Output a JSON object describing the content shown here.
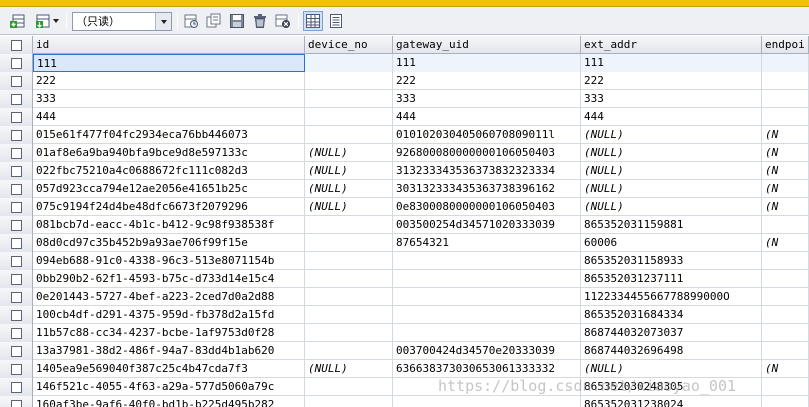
{
  "toolbar": {
    "readonly_label": "（只读）",
    "icons": [
      "add-row-icon",
      "import-icon",
      "refresh-icon",
      "duplicate-icon",
      "save-icon",
      "delete-icon",
      "cancel-icon",
      "grid-view-icon",
      "form-view-icon"
    ]
  },
  "colors": {
    "accent": "#f2c200",
    "selection": "#2f6fd0"
  },
  "grid": {
    "columns": [
      "id",
      "device_no",
      "gateway_uid",
      "ext_addr",
      "endpoi"
    ],
    "rows": [
      {
        "id": "111",
        "device_no": "",
        "gateway_uid": "111",
        "ext_addr": "111",
        "endpoint": ""
      },
      {
        "id": "222",
        "device_no": "",
        "gateway_uid": "222",
        "ext_addr": "222",
        "endpoint": ""
      },
      {
        "id": "333",
        "device_no": "",
        "gateway_uid": "333",
        "ext_addr": "333",
        "endpoint": ""
      },
      {
        "id": "444",
        "device_no": "",
        "gateway_uid": "444",
        "ext_addr": "444",
        "endpoint": ""
      },
      {
        "id": "015e61f477f04fc2934eca76bb446073",
        "device_no": "",
        "gateway_uid": "01010203040506070809011l",
        "ext_addr": "(NULL)",
        "endpoint": "(N"
      },
      {
        "id": "01af8e6a9ba940bfa9bce9d8e597133c",
        "device_no": "(NULL)",
        "gateway_uid": "926800080000000106050403",
        "ext_addr": "(NULL)",
        "endpoint": "(N"
      },
      {
        "id": "022fbc75210a4c0688672fc111c082d3",
        "device_no": "(NULL)",
        "gateway_uid": "313233343536373832323334",
        "ext_addr": "(NULL)",
        "endpoint": "(N"
      },
      {
        "id": "057d923cca794e12ae2056e41651b25c",
        "device_no": "(NULL)",
        "gateway_uid": "303132333435363738396162",
        "ext_addr": "(NULL)",
        "endpoint": "(N"
      },
      {
        "id": "075c9194f24d4be48dfc6673f2079296",
        "device_no": "(NULL)",
        "gateway_uid": "0e8300080000000106050403",
        "ext_addr": "(NULL)",
        "endpoint": "(N"
      },
      {
        "id": "081bcb7d-eacc-4b1c-b412-9c98f938538f",
        "device_no": "",
        "gateway_uid": "003500254d34571020333039",
        "ext_addr": "865352031159881",
        "endpoint": ""
      },
      {
        "id": "08d0cd97c35b452b9a93ae706f99f15e",
        "device_no": "",
        "gateway_uid": "87654321",
        "ext_addr": "60006",
        "endpoint": "(N"
      },
      {
        "id": "094eb688-91c0-4338-96c3-513e8071154b",
        "device_no": "",
        "gateway_uid": "",
        "ext_addr": "865352031158933",
        "endpoint": ""
      },
      {
        "id": "0bb290b2-62f1-4593-b75c-d733d14e15c4",
        "device_no": "",
        "gateway_uid": "",
        "ext_addr": "865352031237111",
        "endpoint": ""
      },
      {
        "id": "0e201443-5727-4bef-a223-2ced7d0a2d88",
        "device_no": "",
        "gateway_uid": "",
        "ext_addr": "112233445566778899000O",
        "endpoint": ""
      },
      {
        "id": "100cb4df-d291-4375-959d-fb378d2a15fd",
        "device_no": "",
        "gateway_uid": "",
        "ext_addr": "865352031684334",
        "endpoint": ""
      },
      {
        "id": "11b57c88-cc34-4237-bcbe-1af9753d0f28",
        "device_no": "",
        "gateway_uid": "",
        "ext_addr": "868744032073037",
        "endpoint": ""
      },
      {
        "id": "13a37981-38d2-486f-94a7-83dd4b1ab620",
        "device_no": "",
        "gateway_uid": "003700424d34570e20333039",
        "ext_addr": "868744032696498",
        "endpoint": ""
      },
      {
        "id": "1405ea9e569040f387c25c4b47cda7f3",
        "device_no": "(NULL)",
        "gateway_uid": "636638373030653061333332",
        "ext_addr": "(NULL)",
        "endpoint": "(N"
      },
      {
        "id": "146f521c-4055-4f63-a29a-577d5060a79c",
        "device_no": "",
        "gateway_uid": "",
        "ext_addr": "865352030248305",
        "endpoint": ""
      },
      {
        "id": "160af3be-9af6-40f0-bd1b-b225d495b282",
        "device_no": "",
        "gateway_uid": "",
        "ext_addr": "865352031238024",
        "endpoint": ""
      }
    ]
  },
  "watermark": "https://blog.csdn.net/xiaoyao_001"
}
